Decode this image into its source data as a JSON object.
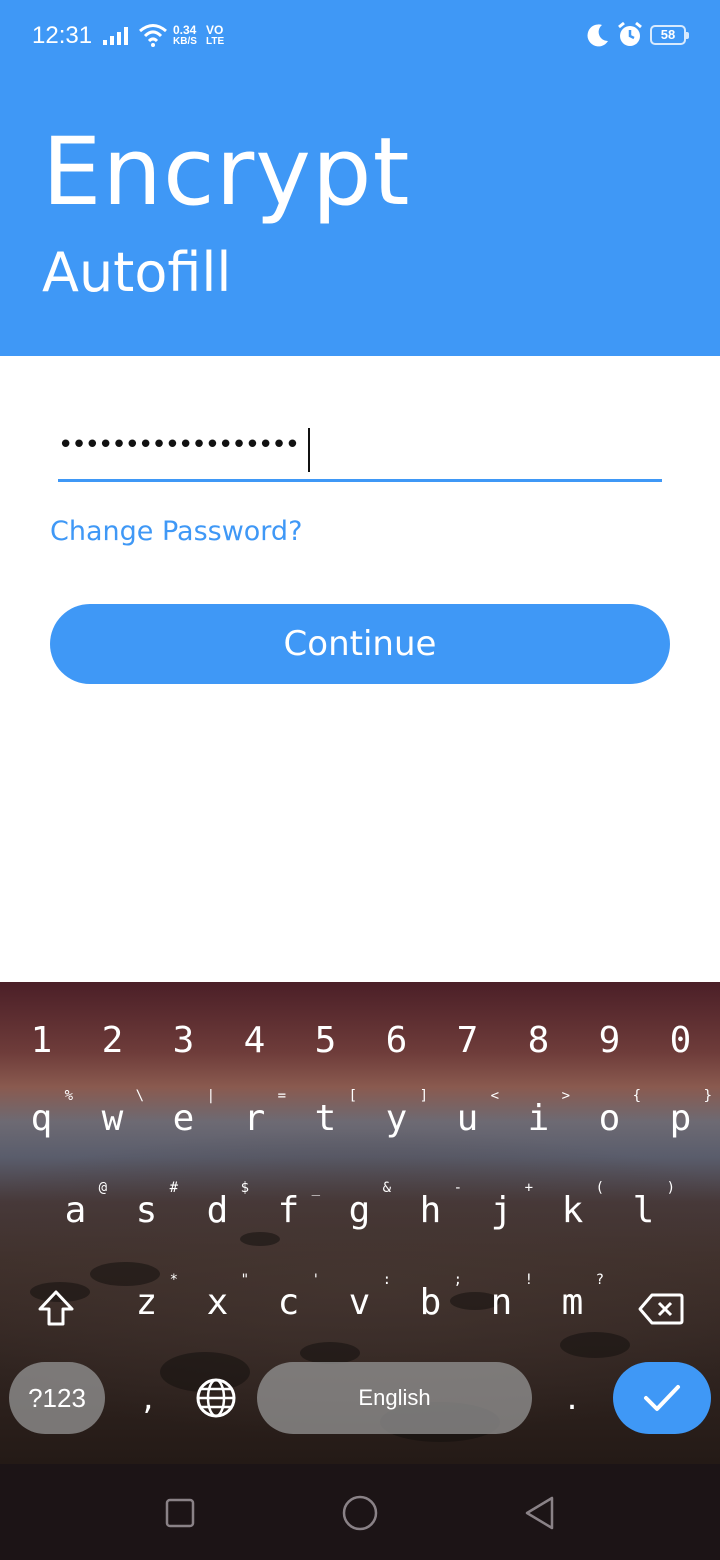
{
  "status_bar": {
    "time": "12:31",
    "net_speed_value": "0.34",
    "net_speed_unit": "KB/S",
    "volte_top": "VO",
    "volte_bottom": "LTE",
    "battery": "58",
    "icons": [
      "signal-icon",
      "wifi-icon",
      "moon-icon",
      "alarm-icon",
      "battery-icon"
    ]
  },
  "header": {
    "title": "Encrypt",
    "subtitle": "Autofill",
    "background_color": "#3f98f6"
  },
  "form": {
    "password_masked": "••••••••••••••••••",
    "change_password_link": "Change Password?",
    "continue_label": "Continue"
  },
  "keyboard": {
    "number_row": [
      "1",
      "2",
      "3",
      "4",
      "5",
      "6",
      "7",
      "8",
      "9",
      "0"
    ],
    "row1": [
      {
        "key": "q",
        "hint": "%"
      },
      {
        "key": "w",
        "hint": "\\"
      },
      {
        "key": "e",
        "hint": "|"
      },
      {
        "key": "r",
        "hint": "="
      },
      {
        "key": "t",
        "hint": "["
      },
      {
        "key": "y",
        "hint": "]"
      },
      {
        "key": "u",
        "hint": "<"
      },
      {
        "key": "i",
        "hint": ">"
      },
      {
        "key": "o",
        "hint": "{"
      },
      {
        "key": "p",
        "hint": "}"
      }
    ],
    "row2": [
      {
        "key": "a",
        "hint": "@"
      },
      {
        "key": "s",
        "hint": "#"
      },
      {
        "key": "d",
        "hint": "$"
      },
      {
        "key": "f",
        "hint": "_"
      },
      {
        "key": "g",
        "hint": "&"
      },
      {
        "key": "h",
        "hint": "-"
      },
      {
        "key": "j",
        "hint": "+"
      },
      {
        "key": "k",
        "hint": "("
      },
      {
        "key": "l",
        "hint": ")"
      }
    ],
    "row3": [
      {
        "key": "z",
        "hint": "*"
      },
      {
        "key": "x",
        "hint": "\""
      },
      {
        "key": "c",
        "hint": "'"
      },
      {
        "key": "v",
        "hint": ":"
      },
      {
        "key": "b",
        "hint": ";"
      },
      {
        "key": "n",
        "hint": "!"
      },
      {
        "key": "m",
        "hint": "?"
      }
    ],
    "symbols_label": "?123",
    "comma": ",",
    "space_label": "English",
    "period": ".",
    "enter_color": "#3f98f6"
  },
  "nav_bar": {
    "buttons": [
      "recents-icon",
      "home-icon",
      "back-icon"
    ]
  }
}
